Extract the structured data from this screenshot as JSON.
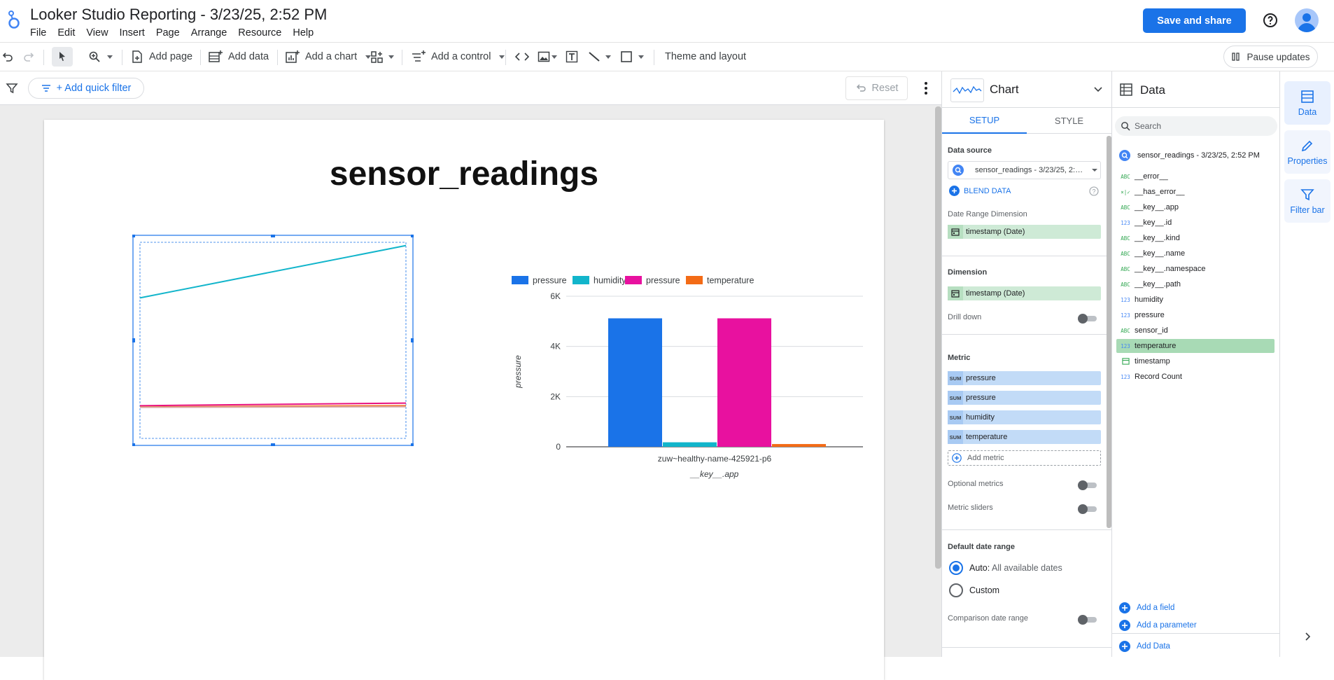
{
  "header": {
    "title": "Looker Studio Reporting - 3/23/25, 2:52 PM",
    "menu": [
      "File",
      "Edit",
      "View",
      "Insert",
      "Page",
      "Arrange",
      "Resource",
      "Help"
    ],
    "save_share": "Save and share"
  },
  "toolbar": {
    "add_page": "Add page",
    "add_data": "Add data",
    "add_chart": "Add a chart",
    "add_control": "Add a control",
    "theme_layout": "Theme and layout",
    "pause_updates": "Pause updates"
  },
  "filterbar": {
    "add_quick_filter": "+ Add quick filter",
    "reset": "Reset"
  },
  "report": {
    "title": "sensor_readings"
  },
  "chart_data": [
    {
      "type": "line",
      "x": [
        0,
        1
      ],
      "series": [
        {
          "values": [
            4300,
            5900
          ],
          "color": "#12b5cb"
        },
        {
          "values": [
            1000,
            1080
          ],
          "color": "#e8117f"
        },
        {
          "values": [
            960,
            1000
          ],
          "color": "#f36b16"
        },
        {
          "values": [
            950,
            970
          ],
          "color": "#d7a7a7"
        }
      ],
      "ylim": [
        0,
        6000
      ]
    },
    {
      "type": "bar",
      "categories": [
        "zuw~healthy-name-425921-p6"
      ],
      "xlabel": "__key__.app",
      "ylabel": "pressure",
      "yticks": [
        "0",
        "2K",
        "4K",
        "6K"
      ],
      "ylim": [
        0,
        6000
      ],
      "legend_position": "top",
      "series": [
        {
          "name": "pressure",
          "values": [
            5120
          ],
          "color": "#1a73e8"
        },
        {
          "name": "humidity",
          "values": [
            180
          ],
          "color": "#12b5cb"
        },
        {
          "name": "pressure",
          "values": [
            5120
          ],
          "color": "#e8119f"
        },
        {
          "name": "temperature",
          "values": [
            110
          ],
          "color": "#f36b16"
        }
      ]
    }
  ],
  "setup_panel": {
    "chart_type": "Chart",
    "tab_setup": "SETUP",
    "tab_style": "STYLE",
    "data_source_label": "Data source",
    "data_source_value": "sensor_readings - 3/23/25, 2:…",
    "blend_data": "BLEND DATA",
    "date_range_dimension_label": "Date Range Dimension",
    "date_range_dimension": "timestamp (Date)",
    "dimension_label": "Dimension",
    "dimension": "timestamp (Date)",
    "drill_down": "Drill down",
    "metric_label": "Metric",
    "metrics": [
      {
        "agg": "SUM",
        "name": "pressure"
      },
      {
        "agg": "SUM",
        "name": "pressure"
      },
      {
        "agg": "SUM",
        "name": "humidity"
      },
      {
        "agg": "SUM",
        "name": "temperature"
      }
    ],
    "add_metric": "Add metric",
    "optional_metrics": "Optional metrics",
    "metric_sliders": "Metric sliders",
    "default_date_range_label": "Default date range",
    "auto_label": "Auto:",
    "auto_value": "All available dates",
    "custom_label": "Custom",
    "comparison_date_range": "Comparison date range"
  },
  "data_panel": {
    "title": "Data",
    "search_placeholder": "Search",
    "data_source": "sensor_readings - 3/23/25, 2:52 PM",
    "fields": [
      {
        "type": "ABC",
        "name": "__error__"
      },
      {
        "type": "×|✓",
        "name": "__has_error__"
      },
      {
        "type": "ABC",
        "name": "__key__.app"
      },
      {
        "type": "123",
        "name": "__key__.id"
      },
      {
        "type": "ABC",
        "name": "__key__.kind"
      },
      {
        "type": "ABC",
        "name": "__key__.name"
      },
      {
        "type": "ABC",
        "name": "__key__.namespace"
      },
      {
        "type": "ABC",
        "name": "__key__.path"
      },
      {
        "type": "123",
        "name": "humidity"
      },
      {
        "type": "123",
        "name": "pressure"
      },
      {
        "type": "ABC",
        "name": "sensor_id"
      },
      {
        "type": "123",
        "name": "temperature"
      },
      {
        "type": "date",
        "name": "timestamp"
      },
      {
        "type": "123",
        "name": "Record Count"
      }
    ],
    "add_field": "Add a field",
    "add_parameter": "Add a parameter",
    "add_data": "Add Data"
  },
  "right_rail": {
    "data": "Data",
    "properties": "Properties",
    "filter_bar": "Filter bar"
  }
}
